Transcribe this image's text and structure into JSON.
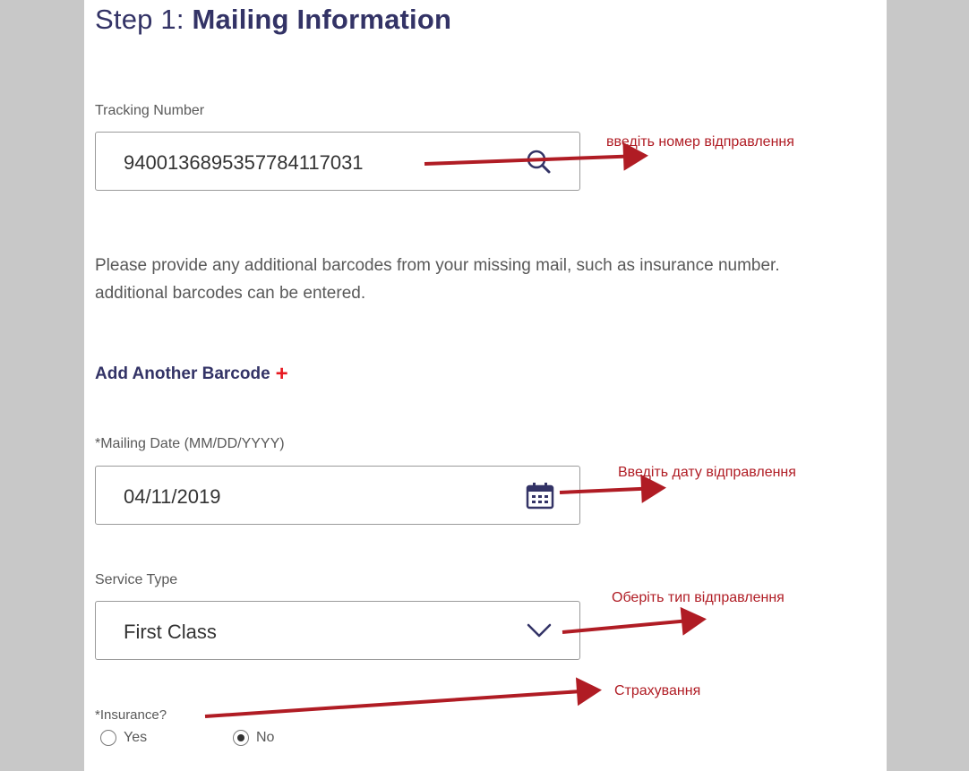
{
  "step": {
    "prefix": "Step 1:",
    "title": "Mailing Information"
  },
  "tracking": {
    "label": "Tracking Number",
    "value": "9400136895357784117031"
  },
  "help": {
    "line1": "Please provide any additional barcodes from your missing mail, such as insurance number.",
    "line2": "additional barcodes can be entered."
  },
  "add_barcode": {
    "label": "Add Another Barcode",
    "plus": "+"
  },
  "mailing_date": {
    "label": "*Mailing Date (MM/DD/YYYY)",
    "value": "04/11/2019"
  },
  "service_type": {
    "label": "Service Type",
    "value": "First Class"
  },
  "insurance": {
    "label": "*Insurance?",
    "options": [
      {
        "label": "Yes",
        "checked": false
      },
      {
        "label": "No",
        "checked": true
      }
    ]
  },
  "annotations": {
    "tracking": "введіть номер відправлення",
    "date": "Введіть дату відправлення",
    "service": "Оберіть тип відправлення",
    "insurance": "Страхування"
  },
  "colors": {
    "annotation": "#b01c24",
    "title": "#333366",
    "plus": "#e71921"
  },
  "icons": {
    "tracking": "search-icon",
    "date": "calendar-icon",
    "service": "chevron-down-icon"
  }
}
